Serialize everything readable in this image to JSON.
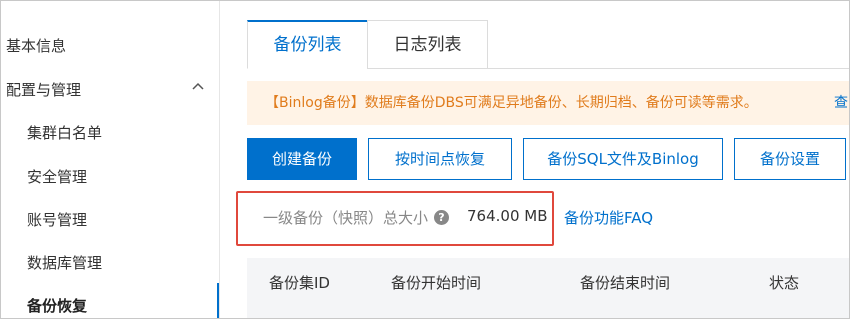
{
  "sidebar": {
    "items": [
      {
        "label": "基本信息"
      },
      {
        "label": "配置与管理"
      },
      {
        "label": "集群白名单"
      },
      {
        "label": "安全管理"
      },
      {
        "label": "账号管理"
      },
      {
        "label": "数据库管理"
      },
      {
        "label": "备份恢复"
      }
    ],
    "expanded_icon": "chevron-up-icon",
    "active_item": "备份恢复",
    "accent": "#0070cc"
  },
  "tabs": [
    {
      "label": "备份列表",
      "active": true
    },
    {
      "label": "日志列表",
      "active": false
    }
  ],
  "notice": {
    "text": "【Binlog备份】数据库备份DBS可满足异地备份、长期归档、备份可读等需求。",
    "link": "查"
  },
  "toolbar": {
    "create_label": "创建备份",
    "pitr_label": "按时间点恢复",
    "sql_binlog_label": "备份SQL文件及Binlog",
    "settings_label": "备份设置"
  },
  "backup_size": {
    "label": "一级备份（快照）总大小",
    "help_icon": "question-circle-icon",
    "value": "764.00 MB",
    "highlight_color": "#e0483c"
  },
  "faq_link": "备份功能FAQ",
  "table": {
    "columns": [
      "备份集ID",
      "备份开始时间",
      "备份结束时间",
      "状态"
    ]
  }
}
